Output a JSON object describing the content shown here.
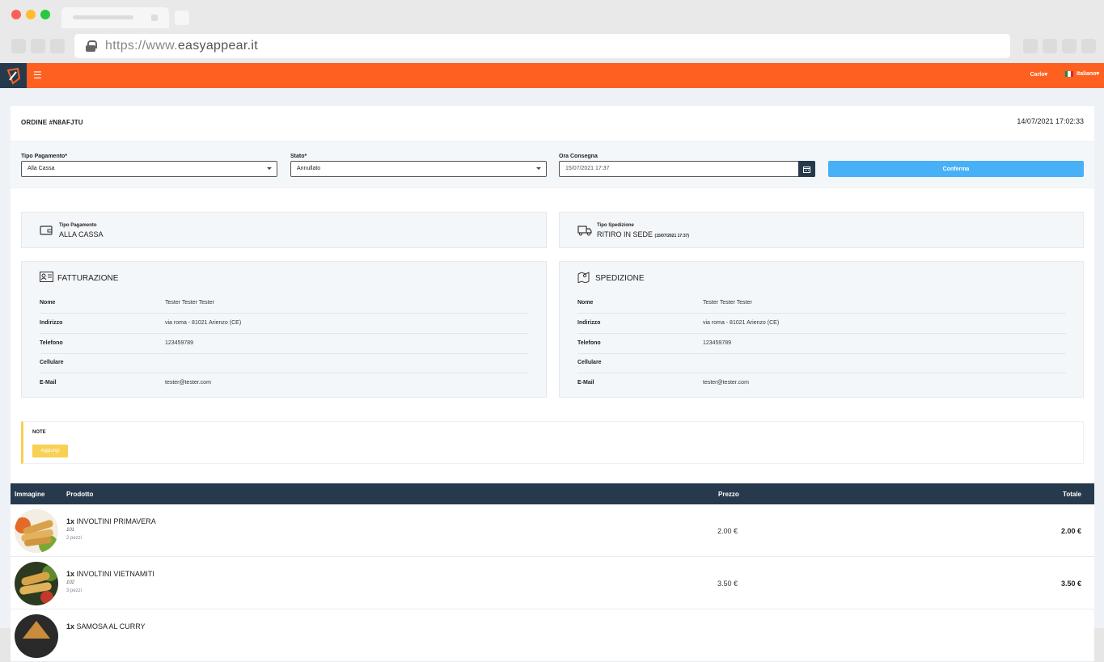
{
  "browser": {
    "url_prefix": "https://www.",
    "url_domain": "easyappear.it",
    "dot_colors": [
      "#fe5f57",
      "#febc2e",
      "#28c840"
    ]
  },
  "header": {
    "menu_icon": "☰",
    "user": "Carlo▾",
    "language": "Italiano▾",
    "brand_color": "#fe6020",
    "dark_color": "#273a4d"
  },
  "order": {
    "title": "ORDINE #N8AFJTU",
    "date": "14/07/2021 17:02:33"
  },
  "filters": {
    "payment_label": "Tipo Pagamento*",
    "payment_value": "Alla Cassa",
    "status_label": "Stato*",
    "status_value": "Annullato",
    "delivery_label": "Ora Consegna",
    "delivery_value": "15/07/2021 17:37",
    "confirm_label": "Conferma",
    "confirm_color": "#48b0f7"
  },
  "payment_box": {
    "label": "Tipo Pagamento",
    "value": "ALLA CASSA"
  },
  "shipping_box": {
    "label": "Tipo Spedizione",
    "value": "RITIRO IN SEDE",
    "detail": "(15/07/2021 17:37)"
  },
  "billing": {
    "title": "FATTURAZIONE",
    "rows": [
      {
        "k": "Nome",
        "v": "Tester Tester Tester"
      },
      {
        "k": "Indirizzo",
        "v": "via roma - 81021 Arienzo (CE)"
      },
      {
        "k": "Telefono",
        "v": "123459789"
      },
      {
        "k": "Cellulare",
        "v": ""
      },
      {
        "k": "E-Mail",
        "v": "tester@tester.com"
      }
    ]
  },
  "shipping": {
    "title": "SPEDIZIONE",
    "rows": [
      {
        "k": "Nome",
        "v": "Tester Tester Tester"
      },
      {
        "k": "Indirizzo",
        "v": "via roma - 81021 Arienzo (CE)"
      },
      {
        "k": "Telefono",
        "v": "123459789"
      },
      {
        "k": "Cellulare",
        "v": ""
      },
      {
        "k": "E-Mail",
        "v": "tester@tester.com"
      }
    ]
  },
  "note": {
    "title": "NOTE",
    "button": "Aggiungi",
    "accent": "#f8d053"
  },
  "table": {
    "headers": {
      "image": "Immagine",
      "product": "Prodotto",
      "price": "Prezzo",
      "total": "Totale"
    },
    "rows": [
      {
        "qty": "1x",
        "name": "INVOLTINI PRIMAVERA",
        "code": "101",
        "desc": "2 pezzi",
        "price": "2.00 €",
        "total": "2.00 €"
      },
      {
        "qty": "1x",
        "name": "INVOLTINI VIETNAMITI",
        "code": "102",
        "desc": "3 pezzi",
        "price": "3.50 €",
        "total": "3.50 €"
      },
      {
        "qty": "1x",
        "name": "SAMOSA AL CURRY",
        "code": "",
        "desc": "",
        "price": "",
        "total": ""
      }
    ]
  }
}
